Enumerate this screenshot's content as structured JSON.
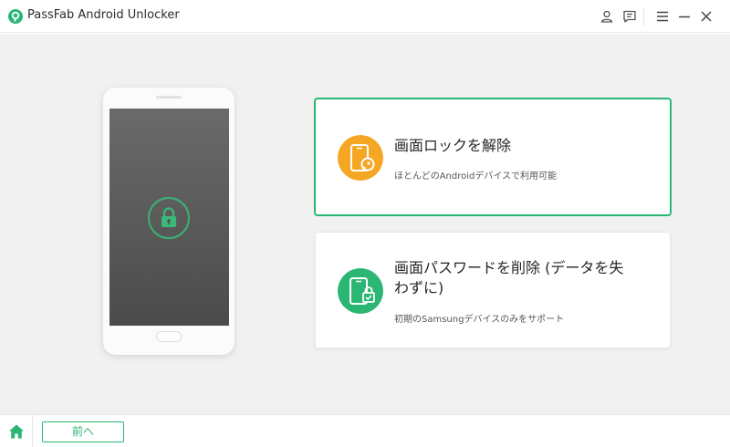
{
  "app": {
    "title": "PassFab Android Unlocker"
  },
  "titlebar": {
    "icons": [
      "user-icon",
      "feedback-icon",
      "menu-icon",
      "minimize-icon",
      "close-icon"
    ]
  },
  "options": [
    {
      "title": "画面ロックを解除",
      "description": "ほとんどのAndroidデバイスで利用可能",
      "icon": "phone-key-icon",
      "icon_color": "#f5a623",
      "selected": true
    },
    {
      "title_line1": "画面パスワードを削除 (データを失",
      "title_line2": "わずに)",
      "description": "初期のSamsungデバイスのみをサポート",
      "icon": "phone-lock-icon",
      "icon_color": "#2bb673",
      "selected": false
    }
  ],
  "footer": {
    "back_label": "前へ"
  },
  "colors": {
    "accent": "#2bb673",
    "orange": "#f5a623"
  }
}
